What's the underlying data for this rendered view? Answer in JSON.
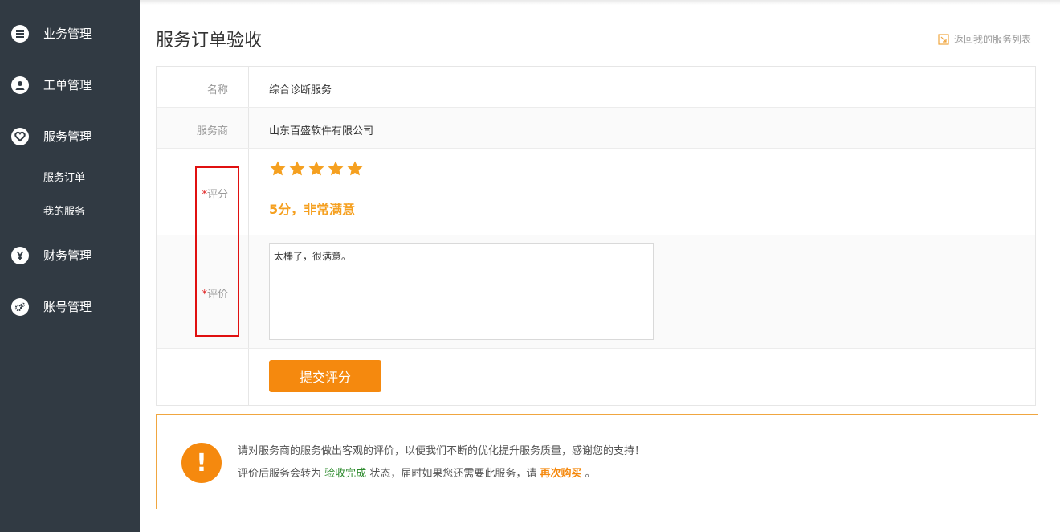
{
  "sidebar": {
    "items": [
      {
        "label": "业务管理",
        "icon": "server-icon"
      },
      {
        "label": "工单管理",
        "icon": "user-icon"
      },
      {
        "label": "服务管理",
        "icon": "heart-icon"
      },
      {
        "label": "财务管理",
        "icon": "yen-icon"
      },
      {
        "label": "账号管理",
        "icon": "gears-icon"
      }
    ],
    "sub_items": [
      {
        "label": "服务订单"
      },
      {
        "label": "我的服务"
      }
    ]
  },
  "header": {
    "title": "服务订单验收",
    "back_link": "返回我的服务列表"
  },
  "form": {
    "name_label": "名称",
    "name_value": "综合诊断服务",
    "provider_label": "服务商",
    "provider_value": "山东百盛软件有限公司",
    "required_mark": "*",
    "rating_label": "评分",
    "rating_value": 5,
    "rating_max": 5,
    "rating_text": "5分，非常满意",
    "comment_label": "评价",
    "comment_value": "太棒了，很满意。",
    "submit_label": "提交评分"
  },
  "notice": {
    "line1": "请对服务商的服务做出客观的评价，以便我们不断的优化提升服务质量，感谢您的支持！",
    "line2_prefix": "评价后服务会转为",
    "line2_status": "验收完成",
    "line2_middle": "状态，届时如果您还需要此服务，请",
    "line2_link": "再次购买",
    "line2_suffix": "。",
    "icon": "!"
  },
  "colors": {
    "sidebar_bg": "#313a43",
    "accent": "#f5890e",
    "star": "#f5a020",
    "required": "#e02020",
    "highlight": "#e01010",
    "status_green": "#2e8b2e"
  }
}
